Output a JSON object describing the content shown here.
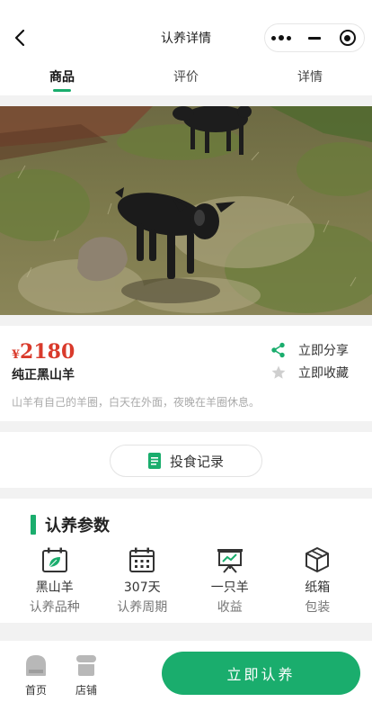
{
  "header": {
    "title": "认养详情",
    "back_icon": "chevron-left-icon",
    "more_icon": "more-dots-icon",
    "minimize_icon": "minimize-icon",
    "close_icon": "target-close-icon"
  },
  "tabs": [
    {
      "label": "商品",
      "active": true
    },
    {
      "label": "评价",
      "active": false
    },
    {
      "label": "详情",
      "active": false
    }
  ],
  "hero": {
    "image": "photo of black goats on grassy hillside"
  },
  "product": {
    "currency": "¥",
    "price": "2180",
    "name": "纯正黑山羊",
    "description": "山羊有自己的羊圈，白天在外面，夜晚在羊圈休息。",
    "price_color": "#d93a2b"
  },
  "actions": {
    "share": {
      "label": "立即分享",
      "icon": "share-icon"
    },
    "favorite": {
      "label": "立即收藏",
      "icon": "star-icon"
    }
  },
  "feeding": {
    "label": "投食记录",
    "icon": "document-icon"
  },
  "params": {
    "title": "认养参数",
    "items": [
      {
        "value": "黑山羊",
        "label": "认养品种",
        "icon": "calendar-leaf-icon"
      },
      {
        "value": "307天",
        "label": "认养周期",
        "icon": "calendar-icon"
      },
      {
        "value": "一只羊",
        "label": "收益",
        "icon": "easel-chart-icon"
      },
      {
        "value": "纸箱",
        "label": "包装",
        "icon": "box-icon"
      }
    ]
  },
  "bottom": {
    "home": {
      "label": "首页",
      "icon": "home-icon"
    },
    "shop": {
      "label": "店铺",
      "icon": "shop-icon"
    },
    "cta": "立即认养"
  },
  "colors": {
    "accent": "#1aad6d",
    "background": "#f2f2f2"
  }
}
